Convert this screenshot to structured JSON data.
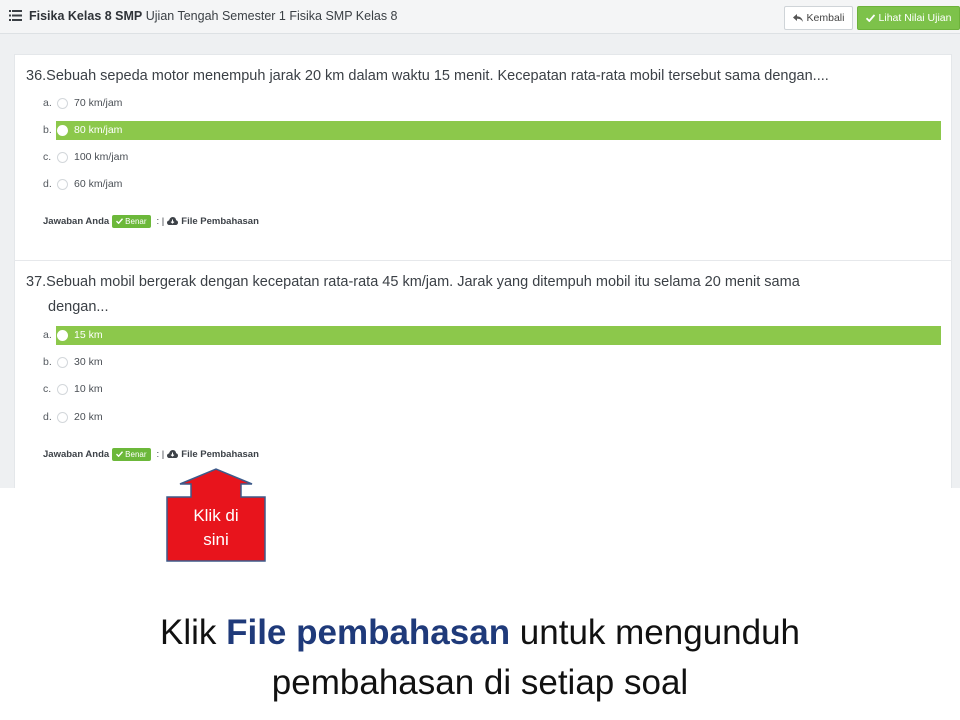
{
  "header": {
    "course": "Fisika Kelas 8 SMP",
    "exam_title": "Ujian Tengah Semester 1 Fisika SMP Kelas 8",
    "back_label": "Kembali",
    "view_score_label": "Lihat Nilai Ujian"
  },
  "questions": [
    {
      "text": "36.Sebuah sepeda motor menempuh jarak 20 km dalam waktu 15 menit. Kecepatan rata-rata mobil tersebut sama dengan....",
      "options": [
        {
          "letter": "a.",
          "text": "70 km/jam",
          "selected": false
        },
        {
          "letter": "b.",
          "text": "80 km/jam",
          "selected": true
        },
        {
          "letter": "c.",
          "text": "100 km/jam",
          "selected": false
        },
        {
          "letter": "d.",
          "text": "60 km/jam",
          "selected": false
        }
      ],
      "answer_label": "Jawaban Anda",
      "status": "Benar",
      "separator": ": |",
      "file_label": "File Pembahasan"
    },
    {
      "text_line1": "37.Sebuah mobil bergerak dengan kecepatan rata-rata 45 km/jam. Jarak yang ditempuh mobil itu selama 20 menit sama",
      "text_line2": "dengan...",
      "options": [
        {
          "letter": "a.",
          "text": "15 km",
          "selected": true
        },
        {
          "letter": "b.",
          "text": "30 km",
          "selected": false
        },
        {
          "letter": "c.",
          "text": "10 km",
          "selected": false
        },
        {
          "letter": "d.",
          "text": "20 km",
          "selected": false
        }
      ],
      "answer_label": "Jawaban Anda",
      "status": "Benar",
      "separator": ": |",
      "file_label": "File Pembahasan"
    }
  ],
  "callout": {
    "line1": "Klik di",
    "line2": "sini"
  },
  "caption": {
    "part1": "Klik ",
    "highlight": "File pembahasan",
    "part2": " untuk mengunduh",
    "line2": "pembahasan di setiap soal"
  },
  "colors": {
    "selected": "#8cc84b",
    "badge": "#6cb83a",
    "callout": "#e8141c",
    "highlight": "#1f3a7a"
  }
}
